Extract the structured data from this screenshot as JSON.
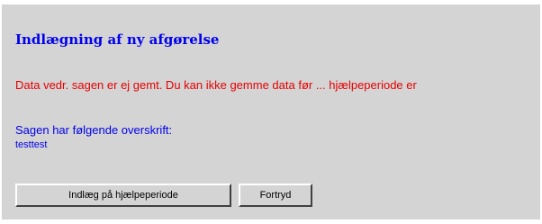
{
  "page": {
    "title": "Indlægning af ny afgørelse",
    "warning": "Data vedr. sagen er ej gemt. Du kan ikke gemme data før ... hjælpeperiode er",
    "case_label": "Sagen har følgende overskrift:",
    "case_value": "testtest"
  },
  "buttons": {
    "insert_label": "Indlæg på hjælpeperiode",
    "cancel_label": "Fortryd"
  },
  "colors": {
    "title": "#0000ee",
    "warning": "#e60000",
    "panel_bg": "#d4d4d4"
  }
}
